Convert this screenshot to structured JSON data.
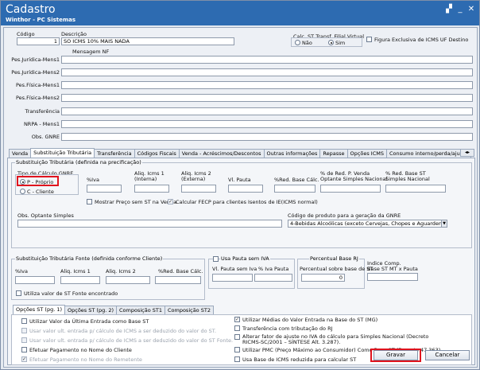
{
  "window": {
    "title": "Cadastro",
    "subtitle": "Winthor - PC Sistemas"
  },
  "header": {
    "codigo_label": "Código",
    "codigo_value": "1",
    "descricao_label": "Descrição",
    "descricao_value": "SO ICMS 10% MAIS NADA",
    "calc_st_label": "Calc. ST Transf. Filial Virtual",
    "nao_label": "Não",
    "sim_label": "Sim",
    "figura_label": "Figura Exclusiva de ICMS UF Destino",
    "mensagem_nf_label": "Mensagem NF",
    "fields": [
      "Pes.Jurídica-Mens1",
      "Pes.Jurídica-Mens2",
      "Pes.Física-Mens1",
      "Pes.Física-Mens2",
      "Transferência",
      "NRPA - Mens1",
      "Obs. GNRE"
    ]
  },
  "tabs": [
    "Venda",
    "Substituição Tributária",
    "Transferência",
    "Códigos Fiscais",
    "Venda - Acréscimos/Descontos",
    "Outras informações",
    "Repasse",
    "Opções ICMS",
    "Consumo interno/perda/ajuste"
  ],
  "st": {
    "group_title": "Substituição Tributária (definida na precificação)",
    "tipo_calculo_label": "Tipo de Cálculo GNRE",
    "proprio_label": "P - Próprio",
    "cliente_label": "C - Cliente",
    "iva_label": "%Iva",
    "aliq1_label": "Aliq. Icms 1\n(Interna)",
    "aliq1_l1": "Aliq. Icms 1",
    "aliq1_l2": "(Interna)",
    "aliq2_l1": "Aliq. Icms 2",
    "aliq2_l2": "(Externa)",
    "pauta_label": "Vl. Pauta",
    "red_base_label": "%Red. Base Cálc.",
    "red_venda_l1": "% de Red. P. Venda",
    "red_venda_l2": "Optante Simples Nacional",
    "red_st_l1": "% Red. Base ST",
    "red_st_l2": "Simples Nacional",
    "mostrar_preco_label": "Mostrar Preço sem ST na Venda",
    "fecp_label": "Calcular FECP para clientes Isentos de IE(ICMS normal)",
    "obs_optante_label": "Obs. Optante Simples",
    "cod_gnre_label": "Código de produto para a geração da GNRE",
    "cod_gnre_value": "4-Bebidas Alcoólicas (exceto Cervejas, Chopes e Aguardente)"
  },
  "st_fonte": {
    "group_title": "Substituição Tributária Fonte (definida conforme Cliente)",
    "iva_label": "%Iva",
    "aliq1_label": "Aliq. Icms 1",
    "aliq2_label": "Aliq. Icms 2",
    "red_base_label": "%Red. Base Cálc.",
    "usa_pauta_label": "Usa Pauta sem IVA",
    "vl_pauta_label": "Vl. Pauta sem Iva",
    "iva_pauta_label": "% Iva Pauta",
    "perc_base_title": "Percentual Base RJ",
    "perc_base_label": "Percentual sobre base de ST",
    "perc_base_value": "0",
    "indice_l1": "Indice Comp.",
    "indice_l2": "Base ST MT x Pauta",
    "utiliza_fonte_label": "Utiliza valor de ST Fonte encontrado"
  },
  "opcoes_tabs": [
    "Opções ST (pg. 1)",
    "Opções ST (pg. 2)",
    "Composição ST1",
    "Composição ST2"
  ],
  "opcoes_left": [
    {
      "label": "Utilizar Valor da Última Entrada como Base ST",
      "enabled": true,
      "checked": false
    },
    {
      "label": "Usar valor ult. entrada p/ cálculo de ICMS a ser deduzido do valor do ST.",
      "enabled": false,
      "checked": false
    },
    {
      "label": "Usar valor ult. entrada p/ cálculo de ICMS a ser deduzido do valor do ST Fonte.",
      "enabled": false,
      "checked": false
    },
    {
      "label": "Efetuar Pagamento no Nome do Cliente",
      "enabled": true,
      "checked": false
    },
    {
      "label": "Efetuar Pagamento no Nome do Remetente",
      "enabled": false,
      "checked": true
    }
  ],
  "opcoes_right": [
    {
      "label": "Utilizar Médias do Valor Entrada na Base do ST (MG)",
      "checked": true
    },
    {
      "label": "Transferência com tributação do RJ",
      "checked": false
    },
    {
      "label": "Alterar fator de ajuste no IVA do cálculo para Simples Nacional (Decreto",
      "label2": "RICMS-SC/2001 – SÍNTESE Alt. 3.287).",
      "checked": false
    },
    {
      "label": "Utilizar PMC (Preço Máximo ao Consumidor) Como Base ST (Decreto 47.363)",
      "checked": false
    },
    {
      "label": "Usa Base de ICMS reduzida para calcular ST",
      "checked": false
    }
  ],
  "buttons": {
    "gravar": "Gravar",
    "cancelar": "Cancelar"
  }
}
